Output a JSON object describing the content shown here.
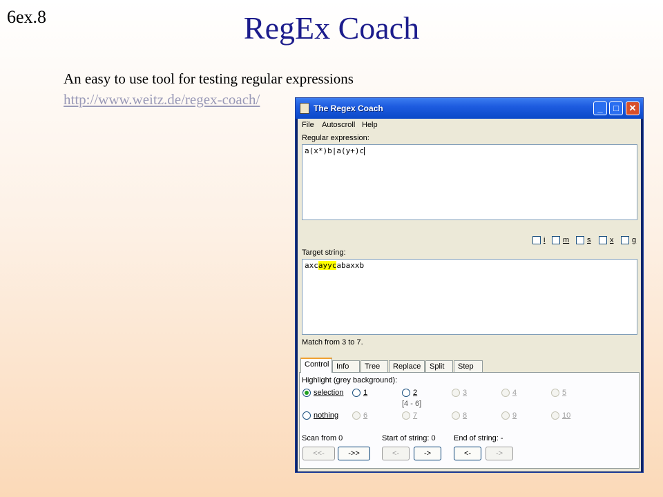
{
  "slide": {
    "number": "6ex.8",
    "title": "RegEx Coach",
    "description": "An easy to use tool for testing regular expressions",
    "url": "http://www.weitz.de/regex-coach/"
  },
  "window": {
    "title": "The Regex Coach",
    "buttons": {
      "minimize": "_",
      "maximize": "□",
      "close": "✕"
    },
    "menu": [
      "File",
      "Autoscroll",
      "Help"
    ],
    "regex_label": "Regular expression:",
    "regex_value": "a(x*)b|a(y+)c",
    "flags": [
      "i",
      "m",
      "s",
      "x",
      "g"
    ],
    "target_label": "Target string:",
    "target": {
      "before": "axc",
      "match": "ayyc",
      "after": "abaxxb"
    },
    "status": "Match from 3 to 7.",
    "tabs": [
      "Control",
      "Info",
      "Tree",
      "Replace",
      "Split",
      "Step"
    ],
    "active_tab": "Control",
    "highlight_label": "Highlight (grey background):",
    "radios": [
      {
        "label": "selection",
        "selected": true,
        "enabled": true
      },
      {
        "label": "1",
        "selected": false,
        "enabled": true
      },
      {
        "label": "2",
        "selected": false,
        "enabled": true
      },
      {
        "label": "3",
        "selected": false,
        "enabled": false
      },
      {
        "label": "4",
        "selected": false,
        "enabled": false
      },
      {
        "label": "5",
        "selected": false,
        "enabled": false
      },
      {
        "label": "nothing",
        "selected": false,
        "enabled": true
      },
      {
        "label": "6",
        "selected": false,
        "enabled": false
      },
      {
        "label": "7",
        "selected": false,
        "enabled": false
      },
      {
        "label": "8",
        "selected": false,
        "enabled": false
      },
      {
        "label": "9",
        "selected": false,
        "enabled": false
      },
      {
        "label": "10",
        "selected": false,
        "enabled": false
      }
    ],
    "group2_range": "[4 - 6]",
    "scan_label": "Scan from 0",
    "start_label": "Start of string: 0",
    "end_label": "End of string: -",
    "scan_buttons": [
      {
        "label": "<<-",
        "enabled": false
      },
      {
        "label": "->>",
        "enabled": true
      }
    ],
    "start_buttons": [
      {
        "label": "<-",
        "enabled": false
      },
      {
        "label": "->",
        "enabled": true
      }
    ],
    "end_buttons": [
      {
        "label": "<-",
        "enabled": true
      },
      {
        "label": "->",
        "enabled": false
      }
    ]
  },
  "colors": {
    "title": "#1c1c8c",
    "match_highlight": "#ffff00",
    "titlebar": "#1e5ce0"
  }
}
